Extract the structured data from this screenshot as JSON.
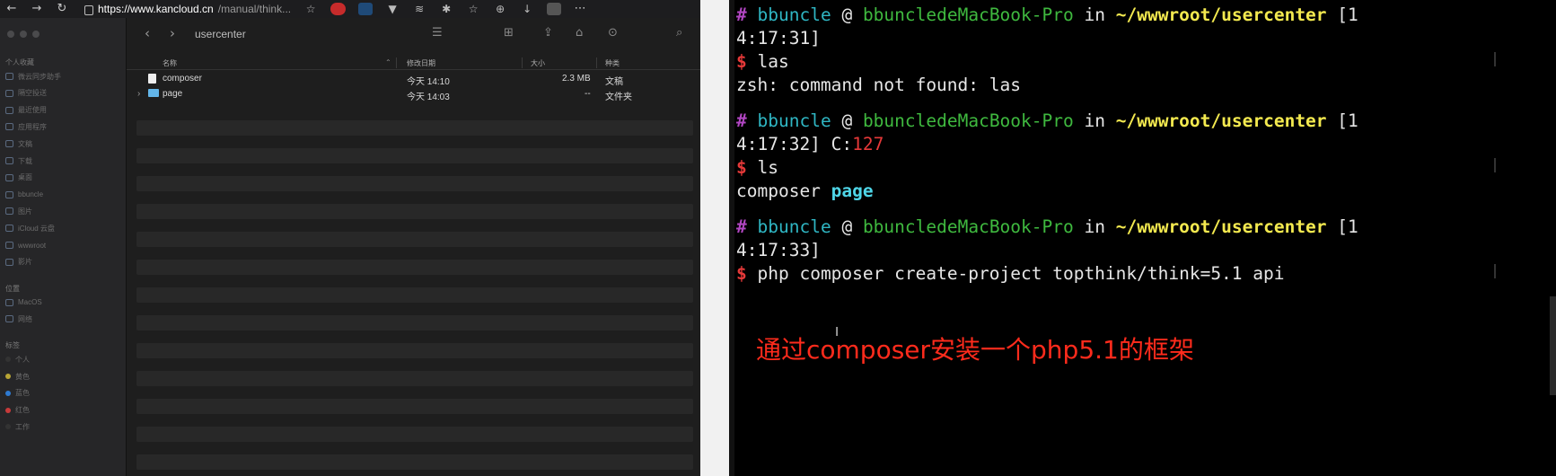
{
  "browser": {
    "url_host": "https://www.kancloud.cn",
    "url_rest": "/manual/think...",
    "nav": {
      "back": "←",
      "forward": "→",
      "reload": "↻"
    },
    "menu": "⋯"
  },
  "finder": {
    "folder_title": "usercenter",
    "toolbar": {
      "back": "‹",
      "forward": "›",
      "view_icon": "☰",
      "grid_icon": "⊞",
      "share_icon": "⇪",
      "tag_icon": "⌂",
      "more_icon": "⊙",
      "search_icon": "⌕"
    },
    "sidebar": {
      "sections": [
        {
          "title": "个人收藏",
          "items": [
            "微云同步助手",
            "隔空投送",
            "最近使用",
            "应用程序",
            "文稿",
            "下载",
            "桌面",
            "bbuncle",
            "图片",
            "iCloud 云盘",
            "wwwroot",
            "影片"
          ]
        },
        {
          "title": "位置",
          "items": [
            "MacOS",
            "网络"
          ]
        },
        {
          "title": "标签",
          "items": [
            "个人",
            "黄色",
            "蓝色",
            "红色",
            "工作"
          ]
        }
      ],
      "tag_colors": [
        "#333333",
        "#b8a535",
        "#2e7ad1",
        "#c73a3a",
        "#333333"
      ]
    },
    "columns": {
      "name": "名称",
      "modified": "修改日期",
      "size": "大小",
      "kind": "种类"
    },
    "files": [
      {
        "name": "composer",
        "modified": "今天 14:10",
        "size": "2.3 MB",
        "kind": "文稿",
        "type": "file"
      },
      {
        "name": "page",
        "modified": "今天 14:03",
        "size": "--",
        "kind": "文件夹",
        "type": "folder"
      }
    ]
  },
  "terminal": {
    "blocks": [
      {
        "user": "bbuncle",
        "host": "bbuncledeMacBook-Pro",
        "path": "~/wwwroot/usercenter",
        "time_a": "[1",
        "time_b": "4:17:31]",
        "exit_code": "",
        "command": "las",
        "output": "zsh: command not found: las"
      },
      {
        "user": "bbuncle",
        "host": "bbuncledeMacBook-Pro",
        "path": "~/wwwroot/usercenter",
        "time_a": "[1",
        "time_b": "4:17:32]",
        "exit_code": "127",
        "command": "ls",
        "output_plain": "composer",
        "output_dir": "page"
      },
      {
        "user": "bbuncle",
        "host": "bbuncledeMacBook-Pro",
        "path": "~/wwwroot/usercenter",
        "time_a": "[1",
        "time_b": "4:17:33]",
        "exit_code": "",
        "command": "php composer create-project topthink/think=5.1 api"
      }
    ],
    "hash": "#",
    "at": "@",
    "in_word": "in",
    "dollar": "$",
    "exit_prefix": "C:",
    "annotation": "通过composer安装一个php5.1的框架"
  },
  "colors": {
    "prompt_hash": "#b146c2",
    "user": "#2fb6c3",
    "host": "#3fb93f",
    "path": "#f3e94f",
    "dollar": "#e63939",
    "annotation": "#ff2b1c"
  }
}
